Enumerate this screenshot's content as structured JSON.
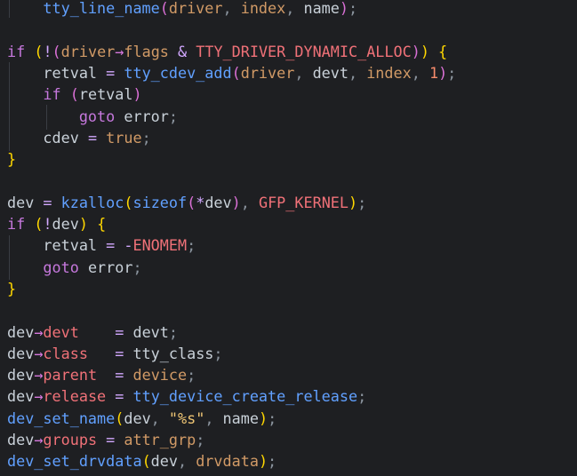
{
  "editor": {
    "lines": [
      {
        "tokens": [
          {
            "t": "    ",
            "c": "t-plain"
          },
          {
            "t": "tty_line_name",
            "c": "t-fn"
          },
          {
            "t": "(",
            "c": "t-br2"
          },
          {
            "t": "driver",
            "c": "t-var"
          },
          {
            "t": ", ",
            "c": "t-punc"
          },
          {
            "t": "index",
            "c": "t-var"
          },
          {
            "t": ", ",
            "c": "t-punc"
          },
          {
            "t": "name",
            "c": "t-plain"
          },
          {
            "t": ")",
            "c": "t-br2"
          },
          {
            "t": ";",
            "c": "t-punc"
          }
        ]
      },
      {
        "tokens": []
      },
      {
        "tokens": [
          {
            "t": "if",
            "c": "t-kw"
          },
          {
            "t": " ",
            "c": "t-plain"
          },
          {
            "t": "(",
            "c": "t-br1"
          },
          {
            "t": "!",
            "c": "t-op"
          },
          {
            "t": "(",
            "c": "t-br2"
          },
          {
            "t": "driver",
            "c": "t-var"
          },
          {
            "t": "→",
            "c": "t-arrow"
          },
          {
            "t": "flags",
            "c": "t-var"
          },
          {
            "t": " & ",
            "c": "t-op"
          },
          {
            "t": "TTY_DRIVER_DYNAMIC_ALLOC",
            "c": "t-const"
          },
          {
            "t": ")",
            "c": "t-br2"
          },
          {
            "t": ")",
            "c": "t-br1"
          },
          {
            "t": " ",
            "c": "t-plain"
          },
          {
            "t": "{",
            "c": "t-br1"
          }
        ]
      },
      {
        "tokens": [
          {
            "t": "    retval ",
            "c": "t-plain"
          },
          {
            "t": "=",
            "c": "t-op"
          },
          {
            "t": " ",
            "c": "t-plain"
          },
          {
            "t": "tty_cdev_add",
            "c": "t-fn"
          },
          {
            "t": "(",
            "c": "t-br2"
          },
          {
            "t": "driver",
            "c": "t-var"
          },
          {
            "t": ", ",
            "c": "t-punc"
          },
          {
            "t": "devt",
            "c": "t-plain"
          },
          {
            "t": ", ",
            "c": "t-punc"
          },
          {
            "t": "index",
            "c": "t-var"
          },
          {
            "t": ", ",
            "c": "t-punc"
          },
          {
            "t": "1",
            "c": "t-num"
          },
          {
            "t": ")",
            "c": "t-br2"
          },
          {
            "t": ";",
            "c": "t-punc"
          }
        ]
      },
      {
        "tokens": [
          {
            "t": "    ",
            "c": "t-plain"
          },
          {
            "t": "if",
            "c": "t-kw"
          },
          {
            "t": " ",
            "c": "t-plain"
          },
          {
            "t": "(",
            "c": "t-br2"
          },
          {
            "t": "retval",
            "c": "t-plain"
          },
          {
            "t": ")",
            "c": "t-br2"
          }
        ]
      },
      {
        "tokens": [
          {
            "t": "        ",
            "c": "t-plain"
          },
          {
            "t": "goto",
            "c": "t-kw"
          },
          {
            "t": " error",
            "c": "t-plain"
          },
          {
            "t": ";",
            "c": "t-punc"
          }
        ]
      },
      {
        "tokens": [
          {
            "t": "    cdev ",
            "c": "t-plain"
          },
          {
            "t": "=",
            "c": "t-op"
          },
          {
            "t": " ",
            "c": "t-plain"
          },
          {
            "t": "true",
            "c": "t-var"
          },
          {
            "t": ";",
            "c": "t-punc"
          }
        ]
      },
      {
        "tokens": [
          {
            "t": "}",
            "c": "t-br1"
          }
        ]
      },
      {
        "tokens": []
      },
      {
        "tokens": [
          {
            "t": "dev ",
            "c": "t-plain"
          },
          {
            "t": "=",
            "c": "t-op"
          },
          {
            "t": " ",
            "c": "t-plain"
          },
          {
            "t": "kzalloc",
            "c": "t-fn"
          },
          {
            "t": "(",
            "c": "t-br1"
          },
          {
            "t": "sizeof",
            "c": "t-fn"
          },
          {
            "t": "(",
            "c": "t-br2"
          },
          {
            "t": "*",
            "c": "t-op"
          },
          {
            "t": "dev",
            "c": "t-plain"
          },
          {
            "t": ")",
            "c": "t-br2"
          },
          {
            "t": ", ",
            "c": "t-punc"
          },
          {
            "t": "GFP_KERNEL",
            "c": "t-const"
          },
          {
            "t": ")",
            "c": "t-br1"
          },
          {
            "t": ";",
            "c": "t-punc"
          }
        ]
      },
      {
        "tokens": [
          {
            "t": "if",
            "c": "t-kw"
          },
          {
            "t": " ",
            "c": "t-plain"
          },
          {
            "t": "(",
            "c": "t-br1"
          },
          {
            "t": "!",
            "c": "t-op"
          },
          {
            "t": "dev",
            "c": "t-plain"
          },
          {
            "t": ")",
            "c": "t-br1"
          },
          {
            "t": " ",
            "c": "t-plain"
          },
          {
            "t": "{",
            "c": "t-br1"
          }
        ]
      },
      {
        "tokens": [
          {
            "t": "    retval ",
            "c": "t-plain"
          },
          {
            "t": "=",
            "c": "t-op"
          },
          {
            "t": " ",
            "c": "t-plain"
          },
          {
            "t": "-",
            "c": "t-op"
          },
          {
            "t": "ENOMEM",
            "c": "t-const"
          },
          {
            "t": ";",
            "c": "t-punc"
          }
        ]
      },
      {
        "tokens": [
          {
            "t": "    ",
            "c": "t-plain"
          },
          {
            "t": "goto",
            "c": "t-kw"
          },
          {
            "t": " error",
            "c": "t-plain"
          },
          {
            "t": ";",
            "c": "t-punc"
          }
        ]
      },
      {
        "tokens": [
          {
            "t": "}",
            "c": "t-br1"
          }
        ]
      },
      {
        "tokens": []
      },
      {
        "tokens": [
          {
            "t": "dev",
            "c": "t-plain"
          },
          {
            "t": "→",
            "c": "t-arrow"
          },
          {
            "t": "devt",
            "c": "t-field"
          },
          {
            "t": "    ",
            "c": "t-plain"
          },
          {
            "t": "=",
            "c": "t-op"
          },
          {
            "t": " devt",
            "c": "t-plain"
          },
          {
            "t": ";",
            "c": "t-punc"
          }
        ]
      },
      {
        "tokens": [
          {
            "t": "dev",
            "c": "t-plain"
          },
          {
            "t": "→",
            "c": "t-arrow"
          },
          {
            "t": "class",
            "c": "t-field"
          },
          {
            "t": "   ",
            "c": "t-plain"
          },
          {
            "t": "=",
            "c": "t-op"
          },
          {
            "t": " tty_class",
            "c": "t-plain"
          },
          {
            "t": ";",
            "c": "t-punc"
          }
        ]
      },
      {
        "tokens": [
          {
            "t": "dev",
            "c": "t-plain"
          },
          {
            "t": "→",
            "c": "t-arrow"
          },
          {
            "t": "parent",
            "c": "t-field"
          },
          {
            "t": "  ",
            "c": "t-plain"
          },
          {
            "t": "=",
            "c": "t-op"
          },
          {
            "t": " ",
            "c": "t-plain"
          },
          {
            "t": "device",
            "c": "t-var"
          },
          {
            "t": ";",
            "c": "t-punc"
          }
        ]
      },
      {
        "tokens": [
          {
            "t": "dev",
            "c": "t-plain"
          },
          {
            "t": "→",
            "c": "t-arrow"
          },
          {
            "t": "release",
            "c": "t-field"
          },
          {
            "t": " ",
            "c": "t-plain"
          },
          {
            "t": "=",
            "c": "t-op"
          },
          {
            "t": " ",
            "c": "t-plain"
          },
          {
            "t": "tty_device_create_release",
            "c": "t-fn"
          },
          {
            "t": ";",
            "c": "t-punc"
          }
        ]
      },
      {
        "tokens": [
          {
            "t": "dev_set_name",
            "c": "t-fn"
          },
          {
            "t": "(",
            "c": "t-br1"
          },
          {
            "t": "dev",
            "c": "t-plain"
          },
          {
            "t": ", ",
            "c": "t-punc"
          },
          {
            "t": "\"%s\"",
            "c": "t-str"
          },
          {
            "t": ", ",
            "c": "t-punc"
          },
          {
            "t": "name",
            "c": "t-plain"
          },
          {
            "t": ")",
            "c": "t-br1"
          },
          {
            "t": ";",
            "c": "t-punc"
          }
        ]
      },
      {
        "tokens": [
          {
            "t": "dev",
            "c": "t-plain"
          },
          {
            "t": "→",
            "c": "t-arrow"
          },
          {
            "t": "groups",
            "c": "t-field"
          },
          {
            "t": " ",
            "c": "t-plain"
          },
          {
            "t": "=",
            "c": "t-op"
          },
          {
            "t": " ",
            "c": "t-plain"
          },
          {
            "t": "attr_grp",
            "c": "t-var"
          },
          {
            "t": ";",
            "c": "t-punc"
          }
        ]
      },
      {
        "tokens": [
          {
            "t": "dev_set_drvdata",
            "c": "t-fn"
          },
          {
            "t": "(",
            "c": "t-br1"
          },
          {
            "t": "dev",
            "c": "t-plain"
          },
          {
            "t": ", ",
            "c": "t-punc"
          },
          {
            "t": "drvdata",
            "c": "t-var"
          },
          {
            "t": ")",
            "c": "t-br1"
          },
          {
            "t": ";",
            "c": "t-punc"
          }
        ]
      }
    ]
  }
}
